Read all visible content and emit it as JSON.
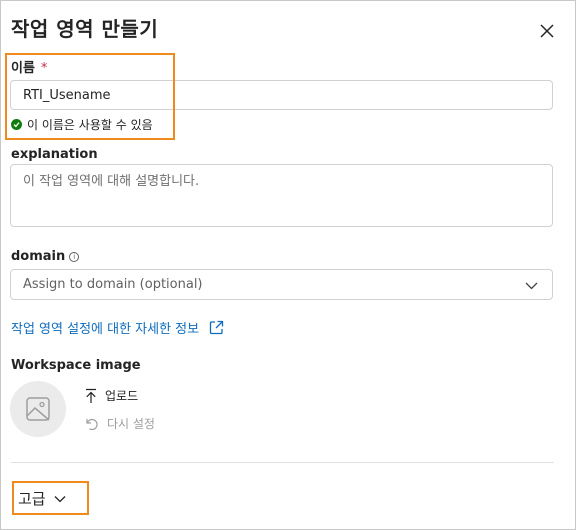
{
  "dialog": {
    "title": "작업 영역 만들기",
    "close_icon": "close-icon"
  },
  "name_field": {
    "label": "이름",
    "required_mark": "*",
    "value": "RTI_Usename",
    "status_text": "이 이름은 사용할 수 있음",
    "status_icon": "check-circle-icon",
    "status_color": "#107c10"
  },
  "description_field": {
    "label": "explanation",
    "placeholder": "이 작업 영역에 대해 설명합니다."
  },
  "domain_field": {
    "label": "domain",
    "info_icon": "i",
    "placeholder": "Assign to domain (optional)"
  },
  "settings_link": {
    "label": "작업 영역 설정에 대한 자세한 정보",
    "color": "#0f6cbd"
  },
  "workspace_image": {
    "label": "Workspace image",
    "upload_label": "업로드",
    "reset_label": "다시 설정"
  },
  "advanced": {
    "label": "고급"
  },
  "colors": {
    "highlight": "#f08a1c",
    "required": "#c4314b"
  }
}
